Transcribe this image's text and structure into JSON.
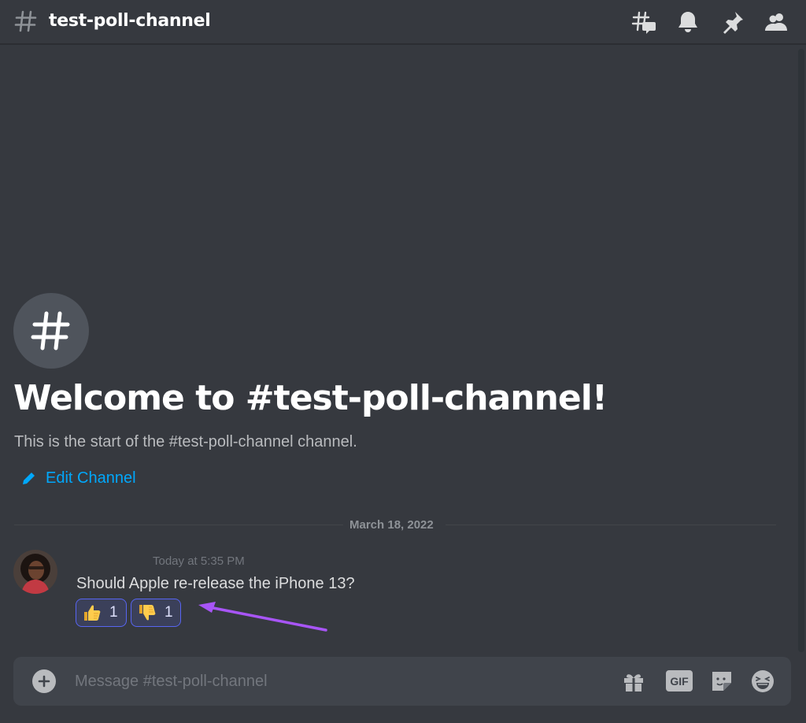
{
  "header": {
    "channel_name": "test-poll-channel",
    "icons": [
      "threads-icon",
      "notification-bell-icon",
      "pinned-messages-icon",
      "member-list-icon"
    ]
  },
  "welcome": {
    "title": "Welcome to #test-poll-channel!",
    "subtitle": "This is the start of the #test-poll-channel channel.",
    "edit_label": "Edit Channel"
  },
  "divider": {
    "date": "March 18, 2022"
  },
  "message": {
    "timestamp": "Today at 5:35 PM",
    "text": "Should Apple re-release the iPhone 13?",
    "reactions": [
      {
        "emoji": "thumbs-up",
        "count": "1"
      },
      {
        "emoji": "thumbs-down",
        "count": "1"
      }
    ]
  },
  "composer": {
    "placeholder": "Message #test-poll-channel",
    "gif_label": "GIF",
    "icons": [
      "add-attachment-icon",
      "gift-icon",
      "gif-icon",
      "sticker-icon",
      "emoji-icon"
    ]
  },
  "colors": {
    "background": "#36393f",
    "link": "#00a8fc",
    "reaction_border": "#5865f2",
    "annotation_arrow": "#a855f7"
  }
}
